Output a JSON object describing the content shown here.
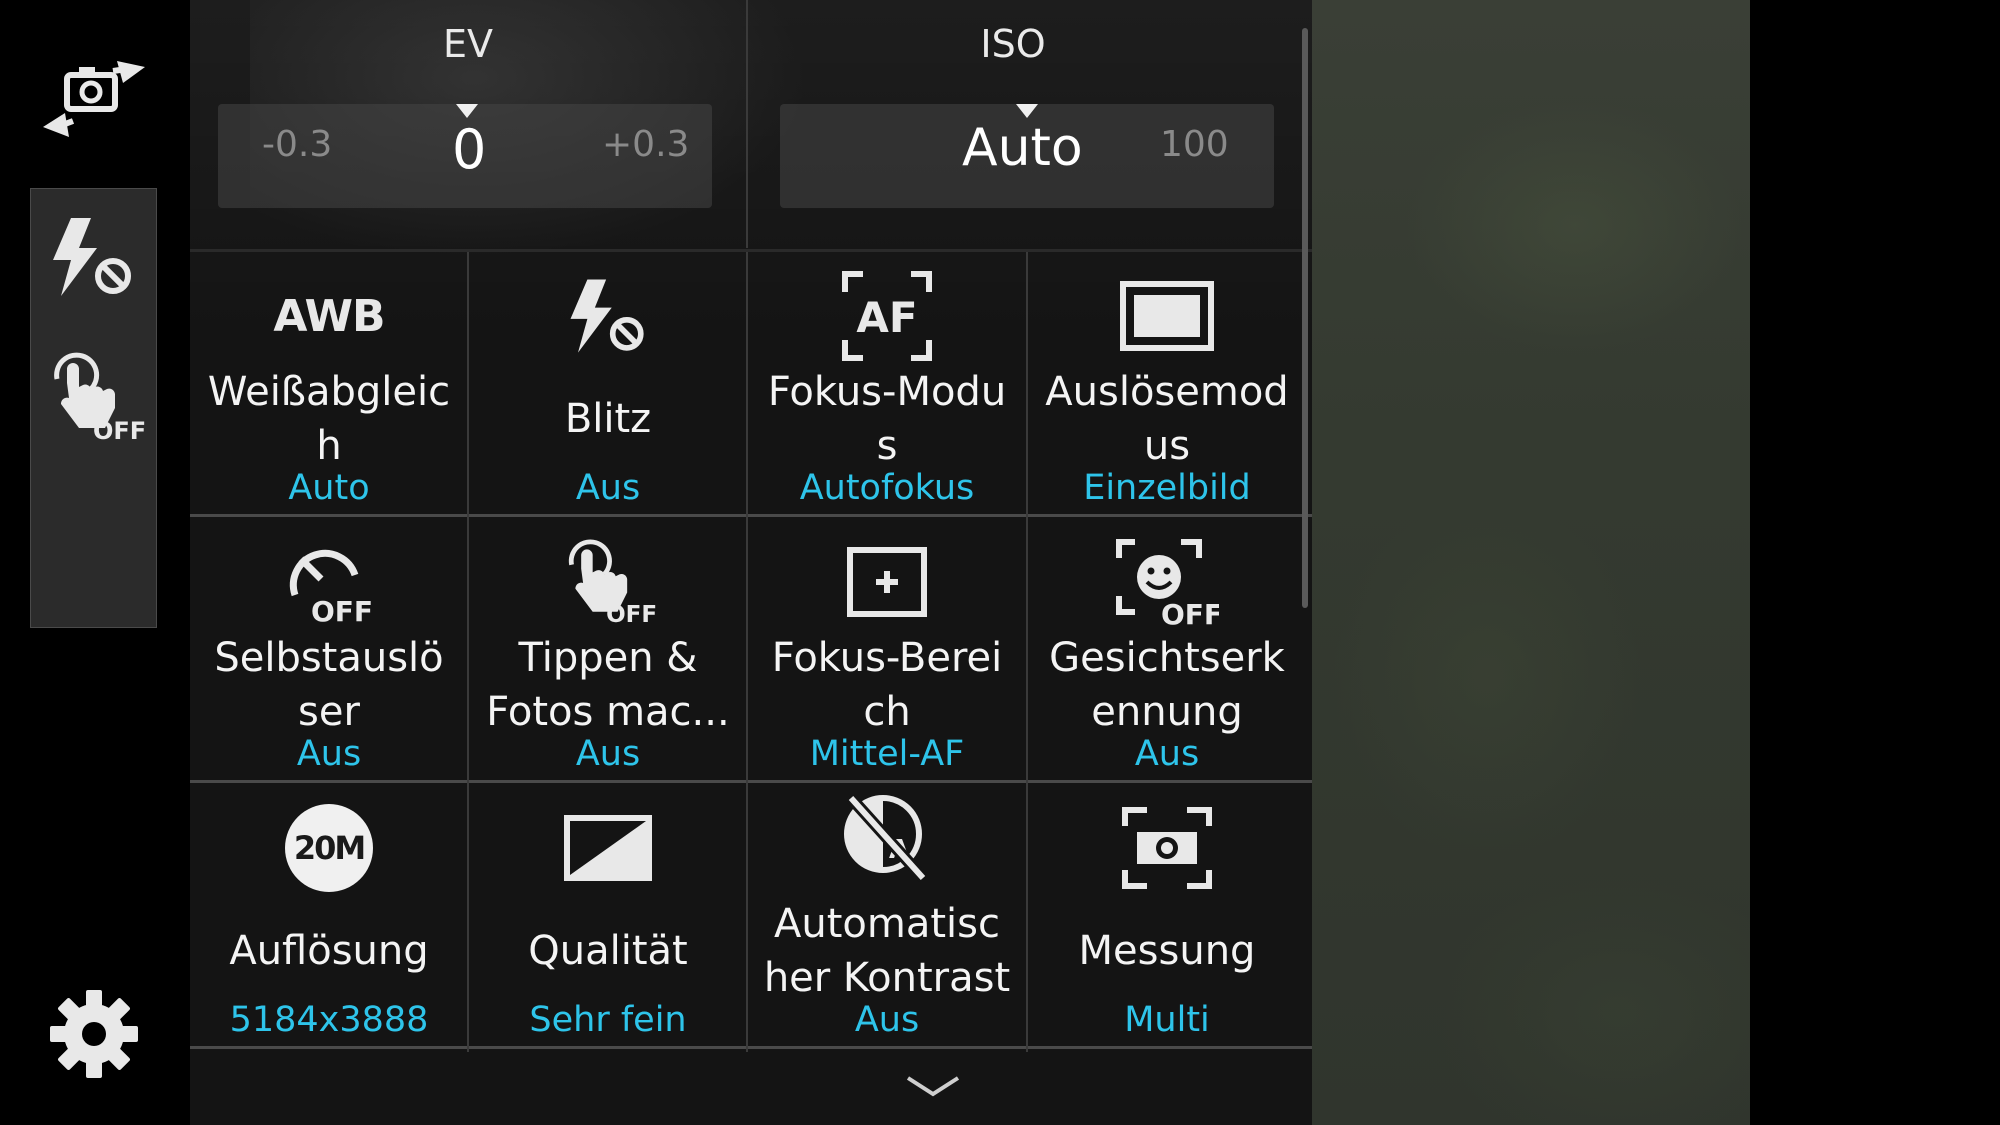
{
  "left_rail": {
    "buttons": [
      {
        "icon": "switch-camera-icon"
      },
      {
        "icon": "flash-off-icon"
      },
      {
        "icon": "touch-shot-off-icon",
        "badge": "OFF"
      },
      {
        "icon": "gear-icon"
      }
    ]
  },
  "ev": {
    "title": "EV",
    "left": "-0.3",
    "current": "0",
    "right": "+0.3"
  },
  "iso": {
    "title": "ISO",
    "current": "Auto",
    "right": "100"
  },
  "grid": [
    {
      "icon": "awb-icon",
      "icon_text": "AWB",
      "label_lines": [
        "Weißabgleic",
        "h"
      ],
      "value": "Auto"
    },
    {
      "icon": "flash-off-icon",
      "label_lines": [
        "Blitz"
      ],
      "value": "Aus"
    },
    {
      "icon": "af-icon",
      "icon_text": "AF",
      "label_lines": [
        "Fokus-Modu",
        "s"
      ],
      "value": "Autofokus"
    },
    {
      "icon": "single-shot-icon",
      "label_lines": [
        "Auslösemod",
        "us"
      ],
      "value": "Einzelbild"
    },
    {
      "icon": "self-timer-off-icon",
      "icon_text": "OFF",
      "label_lines": [
        "Selbstauslö",
        "ser"
      ],
      "value": "Aus"
    },
    {
      "icon": "touch-shot-off-icon",
      "icon_text": "OFF",
      "label_lines": [
        "Tippen &",
        "Fotos mac..."
      ],
      "value": "Aus"
    },
    {
      "icon": "focus-area-icon",
      "label_lines": [
        "Fokus-Berei",
        "ch"
      ],
      "value": "Mittel-AF"
    },
    {
      "icon": "face-detection-off-icon",
      "icon_text": "OFF",
      "label_lines": [
        "Gesichtserk",
        "ennung"
      ],
      "value": "Aus"
    },
    {
      "icon": "resolution-icon",
      "icon_text": "20M",
      "label_lines": [
        "Auflösung"
      ],
      "value": "5184x3888"
    },
    {
      "icon": "quality-icon",
      "label_lines": [
        "Qualität"
      ],
      "value": "Sehr fein"
    },
    {
      "icon": "auto-contrast-off-icon",
      "icon_text": "A",
      "label_lines": [
        "Automatisc",
        "her Kontrast"
      ],
      "value": "Aus"
    },
    {
      "icon": "metering-icon",
      "label_lines": [
        "Messung"
      ],
      "value": "Multi"
    }
  ],
  "colors": {
    "accent": "#2ec4ea",
    "panel": "#141414",
    "text": "#f4f4f4"
  }
}
